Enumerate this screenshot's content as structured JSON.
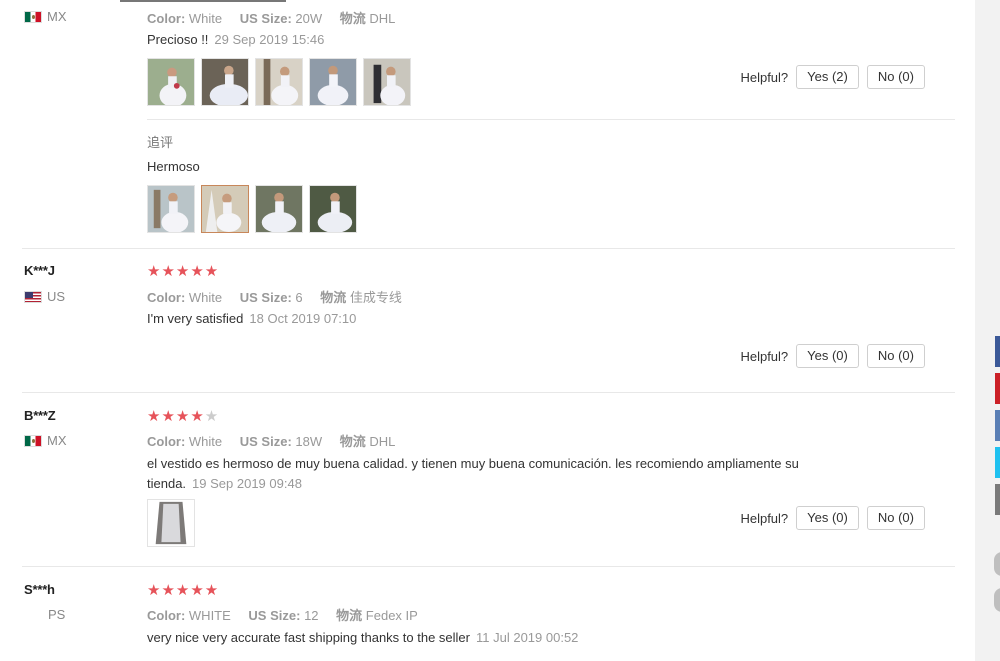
{
  "reviews": [
    {
      "user": "",
      "country": "MX",
      "flag": "flag-mexico-icon",
      "attrs": {
        "color_key": "Color:",
        "color_val": "White",
        "size_key": "US Size:",
        "size_val": "20W",
        "ship_key": "物流",
        "ship_val": "DHL"
      },
      "text": "Precioso !!",
      "date": "29 Sep 2019 15:46",
      "helpful_label": "Helpful?",
      "yes": "Yes (2)",
      "no": "No (0)",
      "append_label": "追评",
      "append_text": "Hermoso"
    },
    {
      "user": "K***J",
      "country": "US",
      "flag": "flag-usa-icon",
      "stars": 5,
      "attrs": {
        "color_key": "Color:",
        "color_val": "White",
        "size_key": "US Size:",
        "size_val": "6",
        "ship_key": "物流",
        "ship_val": "佳成专线"
      },
      "text": "I'm very satisfied",
      "date": "18 Oct 2019 07:10",
      "helpful_label": "Helpful?",
      "yes": "Yes (0)",
      "no": "No (0)"
    },
    {
      "user": "B***Z",
      "country": "MX",
      "flag": "flag-mexico-icon",
      "stars": 4,
      "attrs": {
        "color_key": "Color:",
        "color_val": "White",
        "size_key": "US Size:",
        "size_val": "18W",
        "ship_key": "物流",
        "ship_val": "DHL"
      },
      "text_line1": "el vestido es hermoso de muy buena calidad. y tienen muy buena comunicación. les recomiendo ampliamente su",
      "text_line2": "tienda.",
      "date": "19 Sep 2019 09:48",
      "helpful_label": "Helpful?",
      "yes": "Yes (0)",
      "no": "No (0)"
    },
    {
      "user": "S***h",
      "country": "PS",
      "stars": 5,
      "attrs": {
        "color_key": "Color:",
        "color_val": "WHITE",
        "size_key": "US Size:",
        "size_val": "12",
        "ship_key": "物流",
        "ship_val": "Fedex IP"
      },
      "text": "very nice very accurate fast shipping thanks to the seller",
      "date": "11 Jul 2019 00:52"
    }
  ],
  "colors": {
    "star": "#e6535a",
    "share_tabs": [
      "#3b5998",
      "#cb2027",
      "#5a7fb5",
      "#1fc1f0",
      "#7a7a7a"
    ]
  }
}
